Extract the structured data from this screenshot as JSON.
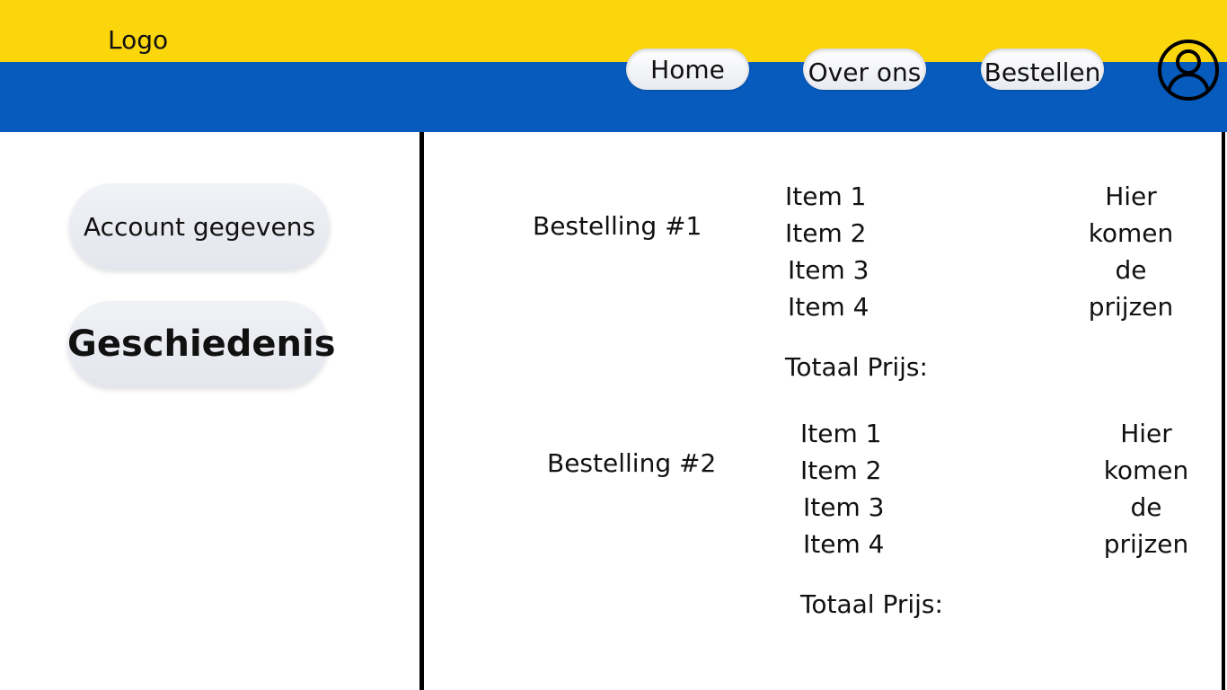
{
  "header": {
    "logo": "Logo",
    "nav": {
      "home": "Home",
      "over_ons": "Over ons",
      "bestellen": "Bestellen"
    },
    "user_icon": "user-account-icon",
    "colors": {
      "top_band": "#fcd60c",
      "bottom_band": "#075bbd"
    }
  },
  "sidebar": {
    "account": "Account gegevens",
    "geschiedenis": "Geschiedenis"
  },
  "orders": [
    {
      "title": "Bestelling #1",
      "items": [
        "Item 1",
        "Item 2",
        "Item 3",
        "Item 4"
      ],
      "prices": [
        "Hier",
        "komen",
        "de",
        "prijzen"
      ],
      "total_label": "Totaal Prijs:"
    },
    {
      "title": "Bestelling #2",
      "items": [
        "Item 1",
        "Item 2",
        "Item 3",
        "Item 4"
      ],
      "prices": [
        "Hier",
        "komen",
        "de",
        "prijzen"
      ],
      "total_label": "Totaal Prijs:"
    }
  ]
}
